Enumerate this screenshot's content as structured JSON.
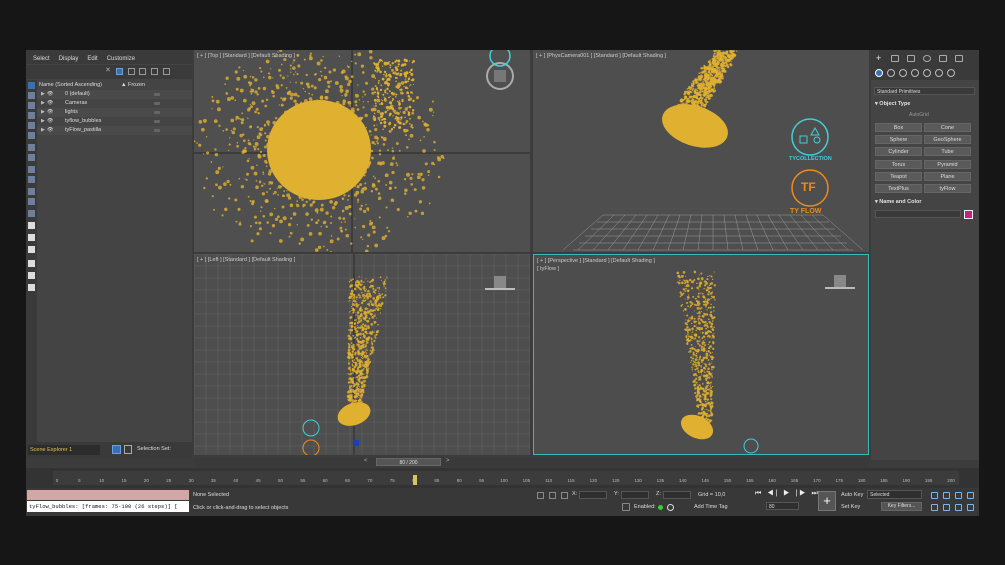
{
  "menu": [
    "Select",
    "Display",
    "Edit",
    "Customize"
  ],
  "explorer": {
    "col_name": "Name (Sorted Ascending)",
    "col_frozen": "▲ Frozen",
    "rows": [
      "0 (default)",
      "Cameras",
      "lights",
      "tyflow_bubbles",
      "tyFlow_pastilla"
    ],
    "dropdown": "Scene Explorer 1",
    "selection_set": "Selection Set:"
  },
  "viewports": {
    "top": "[ + ] [Top ] [Standard ] [Default Shading ]",
    "camera": "[ + ] [PhysCamera001 ] [Standard ] [Default Shading ]",
    "left": "[ + ] [Left ] [Standard ] [Default Shading ]",
    "perspective": "[ + ] [Perspective ] [Standard ] [Default Shading ]",
    "perspective_sub": "[ tyFlow ]"
  },
  "logos": {
    "tycollection": "TYCOLLECTION",
    "tyflow": "TY FLOW",
    "tyflow_glyph": "TF"
  },
  "frame_counter": "80 / 200",
  "command_panel": {
    "dropdown": "Standard Primitives",
    "object_type": "Object Type",
    "autogrid": "AutoGrid",
    "buttons": [
      "Box",
      "Cone",
      "Sphere",
      "GeoSphere",
      "Cylinder",
      "Tube",
      "Torus",
      "Pyramid",
      "Teapot",
      "Plane",
      "TextPlus",
      "tyFlow"
    ],
    "name_color": "Name and Color",
    "swatch_color": "#c8207e"
  },
  "timeline": {
    "ticks": [
      "0",
      "5",
      "10",
      "15",
      "20",
      "25",
      "30",
      "35",
      "40",
      "45",
      "50",
      "55",
      "60",
      "65",
      "70",
      "75",
      "80",
      "85",
      "90",
      "95",
      "100",
      "105",
      "110",
      "115",
      "120",
      "125",
      "130",
      "135",
      "140",
      "145",
      "150",
      "155",
      "160",
      "165",
      "170",
      "175",
      "180",
      "185",
      "190",
      "195",
      "200"
    ],
    "current": 80,
    "max": 200
  },
  "status": {
    "listener": "tyFlow_bubbles: [frames: 75-100 (26 steps)] [",
    "none_selected": "None Selected",
    "prompt": "Click or click-and-drag to select objects",
    "x_label": "X:",
    "y_label": "Y:",
    "z_label": "Z:",
    "grid": "Grid = 10,0",
    "enabled": "Enabled:",
    "add_time_tag": "Add Time Tag",
    "frame_field": "80",
    "auto_key": "Auto Key",
    "set_key": "Set Key",
    "selected": "Selected",
    "key_filters": "Key Filters...",
    "play_controls": "⏮ ◀| ▶ |▶ ⏭",
    "add_key_glyph": "+"
  },
  "colors": {
    "particles": "#e0b030",
    "active_vp": "#3fb6b8",
    "logo_cyan": "#3fd0d8",
    "logo_orange": "#f08a1c"
  }
}
